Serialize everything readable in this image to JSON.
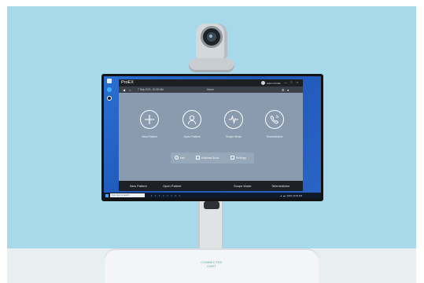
{
  "product": {
    "cart_label": "CONNECTED CART"
  },
  "app": {
    "name": "ProEX",
    "user_name": "Admin Profile",
    "window_controls": [
      "—",
      "□",
      "×"
    ],
    "toolbar": {
      "date": "7 Sep 2021, 10:30 AM",
      "title": "Home",
      "icons": [
        "back-icon",
        "home-icon",
        "settings-icon",
        "notification-icon"
      ]
    },
    "tiles": [
      {
        "label": "New Patient",
        "icon": "plus-icon"
      },
      {
        "label": "Open Patient",
        "icon": "person-icon"
      },
      {
        "label": "Scope Mode",
        "icon": "waveform-icon"
      },
      {
        "label": "Telemedicine",
        "icon": "phone-icon"
      }
    ],
    "links": [
      {
        "label": "Info",
        "icon": "info-icon"
      },
      {
        "label": "Address Book",
        "icon": "address-book-icon"
      },
      {
        "label": "Settings",
        "icon": "settings-icon"
      }
    ],
    "footer": [
      "New Patient",
      "Open Patient",
      "Scope Mode",
      "Telemedicine"
    ]
  },
  "taskbar": {
    "search_placeholder": "Type here to search",
    "tray_text": "▲ ☁ ♪ ENG 10:30 AM"
  },
  "colors": {
    "backdrop": "#a7d9ea",
    "app_bg": "#8a9bb0",
    "titlebar": "#1d1f22",
    "desktop": "#2b6fd0"
  }
}
